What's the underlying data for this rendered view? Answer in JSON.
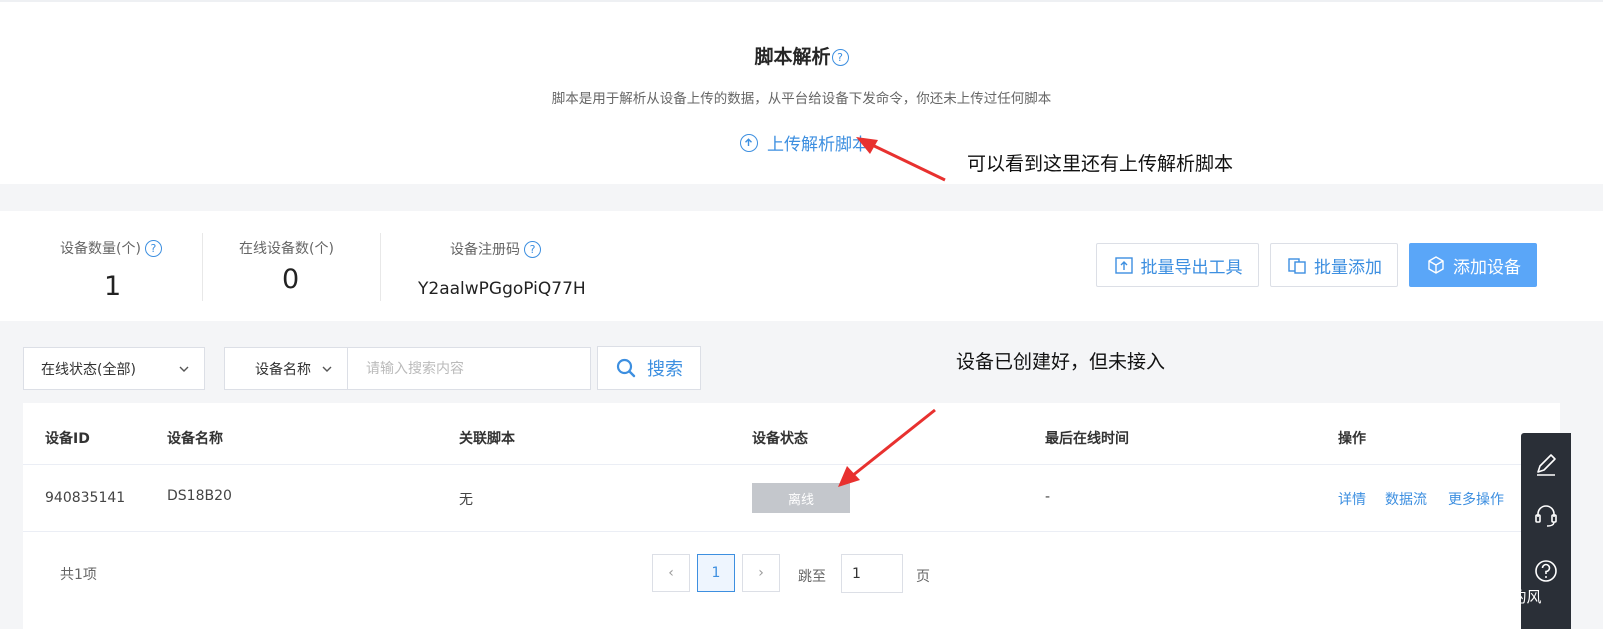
{
  "script_section": {
    "title": "脚本解析",
    "title_help": "?",
    "description": "脚本是用于解析从设备上传的数据，从平台给设备下发命令，你还未上传过任何脚本",
    "upload_label": "上传解析脚本"
  },
  "stats": {
    "device_count_label": "设备数量(个)",
    "device_count": "1",
    "online_count_label": "在线设备数(个)",
    "online_count": "0",
    "reg_code_label": "设备注册码",
    "reg_code": "Y2aalwPGgoPiQ77H",
    "help": "?"
  },
  "actions": {
    "batch_export": "批量导出工具",
    "batch_add": "批量添加",
    "add_device": "添加设备"
  },
  "filters": {
    "status_select": "在线状态(全部)",
    "name_select": "设备名称",
    "search_placeholder": "请输入搜索内容",
    "search_button": "搜索"
  },
  "table": {
    "headers": [
      "设备ID",
      "设备名称",
      "关联脚本",
      "设备状态",
      "最后在线时间",
      "操作"
    ],
    "rows": [
      {
        "id": "940835141",
        "name": "DS18B20",
        "script": "无",
        "status": "离线",
        "last_online": "-",
        "ops": [
          "详情",
          "数据流",
          "更多操作"
        ]
      }
    ]
  },
  "pagination": {
    "total": "共1项",
    "prev": "‹",
    "current": "1",
    "next": "›",
    "jump_label": "跳至",
    "jump_value": "1",
    "page_unit": "页"
  },
  "annotations": {
    "upload_note": "可以看到这里还有上传解析脚本",
    "device_note": "设备已创建好，但未接入"
  },
  "watermark": "CSDN @麓南的风",
  "colors": {
    "accent": "#3d8fe0",
    "primary_button": "#5aa6f8",
    "offline_badge": "#c4c7cc",
    "arrow": "#e8312f"
  }
}
